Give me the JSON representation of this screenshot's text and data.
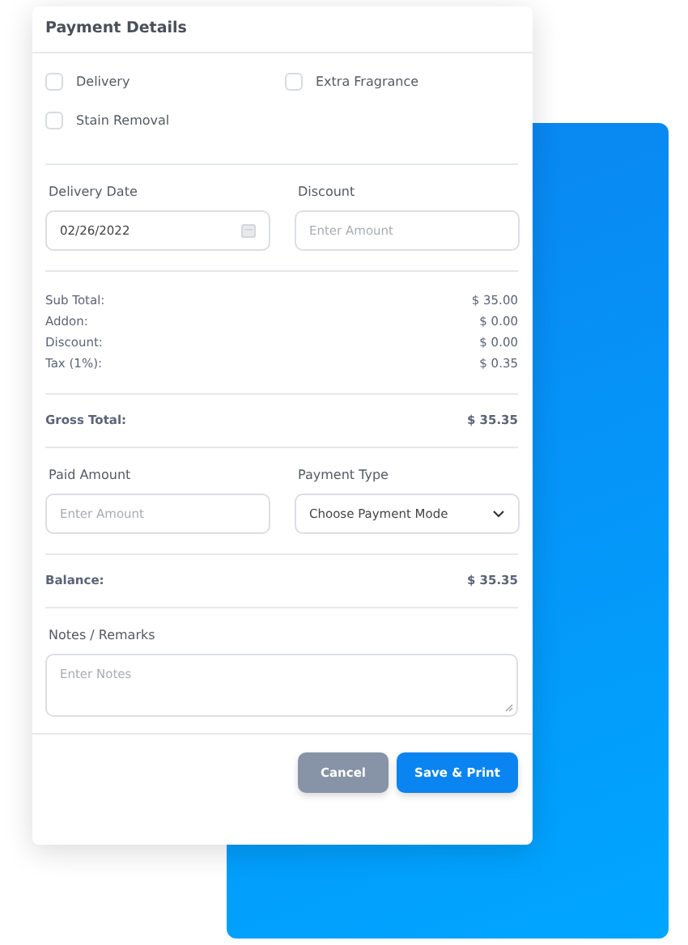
{
  "title": "Payment Details",
  "addons": [
    {
      "label": "Delivery",
      "checked": false
    },
    {
      "label": "Extra Fragrance",
      "checked": false
    },
    {
      "label": "Stain Removal",
      "checked": false
    }
  ],
  "delivery_date": {
    "label": "Delivery Date",
    "value": "02/26/2022"
  },
  "discount": {
    "label": "Discount",
    "placeholder": "Enter Amount"
  },
  "summary": [
    {
      "label": "Sub Total:",
      "value": "$ 35.00"
    },
    {
      "label": "Addon:",
      "value": "$ 0.00"
    },
    {
      "label": "Discount:",
      "value": "$ 0.00"
    },
    {
      "label": "Tax (1%):",
      "value": "$ 0.35"
    }
  ],
  "gross_total": {
    "label": "Gross Total:",
    "value": "$ 35.35"
  },
  "paid_amount": {
    "label": "Paid Amount",
    "placeholder": "Enter Amount"
  },
  "payment_type": {
    "label": "Payment Type",
    "value": "Choose Payment Mode"
  },
  "balance": {
    "label": "Balance:",
    "value": "$ 35.35"
  },
  "notes": {
    "label": "Notes / Remarks",
    "placeholder": "Enter Notes"
  },
  "buttons": [
    {
      "label": "Cancel",
      "kind": "secondary"
    },
    {
      "label": "Save & Print",
      "kind": "primary"
    }
  ]
}
